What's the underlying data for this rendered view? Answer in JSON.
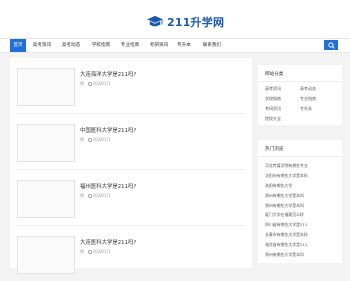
{
  "site": {
    "logo_text": "211升学网"
  },
  "nav": {
    "items": [
      "首页",
      "高考资讯",
      "高考动态",
      "学校指南",
      "专业指南",
      "考研资讯",
      "专升本",
      "联系我们"
    ],
    "active_index": 0
  },
  "posts": [
    {
      "title": "大连海洋大学是211吗?",
      "category": "院",
      "date": "2024/1/1"
    },
    {
      "title": "中国医科大学是211吗?",
      "category": "院",
      "date": "2024/1/1"
    },
    {
      "title": "福州医科大学是211吗?",
      "category": "院",
      "date": "2024/1/1"
    },
    {
      "title": "大连医科大学是211吗?",
      "category": "院",
      "date": "2024/1/1"
    }
  ],
  "sidebar": {
    "categories_title": "网站分类",
    "categories": [
      "高考资讯",
      "高考动态",
      "学校指南",
      "专业指南",
      "考研资讯",
      "专升本",
      "院校大全"
    ],
    "hot_title": "热门浏览",
    "hot": [
      "河北传媒学院有哪些专业",
      "沈阳市有哪些大学是本科",
      "洛阳有哪些大学",
      "郑州有哪些大学是本科",
      "郑州有哪些大学是本科",
      "厦门大学在福建怎么样",
      "四川省有哪些大学是211",
      "长春市有哪些大学是本科",
      "湖北省有哪些大学是211",
      "郑州有哪些大学是本科"
    ]
  }
}
